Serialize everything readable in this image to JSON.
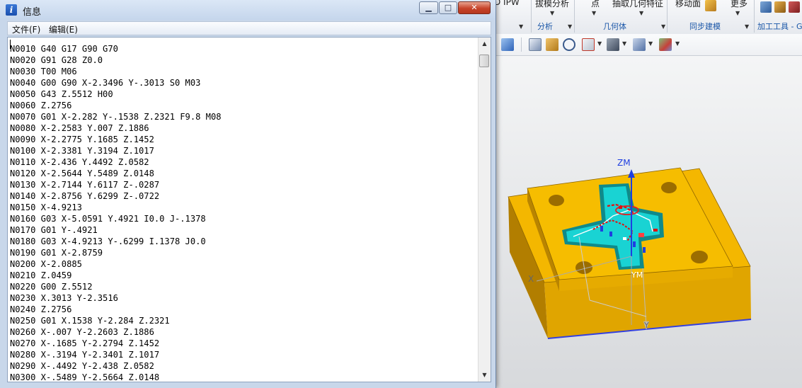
{
  "window": {
    "title": "信息",
    "title_icon": "i",
    "controls": {
      "minimize_glyph": "▁",
      "maximize_glyph": "□",
      "close_glyph": "✕"
    }
  },
  "menu": {
    "items": [
      "文件(F)",
      "编辑(E)"
    ]
  },
  "editor": {
    "lines": [
      "N0010 G40 G17 G90 G70",
      "N0020 G91 G28 Z0.0",
      "N0030 T00 M06",
      "N0040 G00 G90 X-2.3496 Y-.3013 S0 M03",
      "N0050 G43 Z.5512 H00",
      "N0060 Z.2756",
      "N0070 G01 X-2.282 Y-.1538 Z.2321 F9.8 M08",
      "N0080 X-2.2583 Y.007 Z.1886",
      "N0090 X-2.2775 Y.1685 Z.1452",
      "N0100 X-2.3381 Y.3194 Z.1017",
      "N0110 X-2.436 Y.4492 Z.0582",
      "N0120 X-2.5644 Y.5489 Z.0148",
      "N0130 X-2.7144 Y.6117 Z-.0287",
      "N0140 X-2.8756 Y.6299 Z-.0722",
      "N0150 X-4.9213",
      "N0160 G03 X-5.0591 Y.4921 I0.0 J-.1378",
      "N0170 G01 Y-.4921",
      "N0180 G03 X-4.9213 Y-.6299 I.1378 J0.0",
      "N0190 G01 X-2.8759",
      "N0200 X-2.0885",
      "N0210 Z.0459",
      "N0220 G00 Z.5512",
      "N0230 X.3013 Y-2.3516",
      "N0240 Z.2756",
      "N0250 G01 X.1538 Y-2.284 Z.2321",
      "N0260 X-.007 Y-2.2603 Z.1886",
      "N0270 X-.1685 Y-2.2794 Z.1452",
      "N0280 X-.3194 Y-2.3401 Z.1017",
      "N0290 X-.4492 Y-2.438 Z.0582",
      "N0300 X-.5489 Y-2.5664 Z.0148"
    ]
  },
  "ribbon": {
    "top_labels": [
      "D IPW",
      "拔模分析",
      "点",
      "抽取几何特征",
      "移动面",
      "更多"
    ],
    "groups": [
      "分析",
      "几何体",
      "同步建模",
      "加工工具 - G"
    ]
  },
  "viewport": {
    "axis_labels": {
      "zm": "ZM",
      "ym": "YM",
      "x": "X",
      "y": "Y"
    },
    "colors": {
      "part": "#f2b600",
      "part_dark": "#c98e00",
      "pocket_floor": "#1ad6d6",
      "axis_blue": "#1f3fe0",
      "toolpath_red": "#e01010"
    }
  },
  "icons": {
    "title": "info-icon",
    "toolbar": [
      "cube-icon",
      "fit-view-icon",
      "refresh-icon",
      "layout-icon",
      "shade-icon",
      "solid-cube-icon",
      "render-style-icon"
    ]
  }
}
